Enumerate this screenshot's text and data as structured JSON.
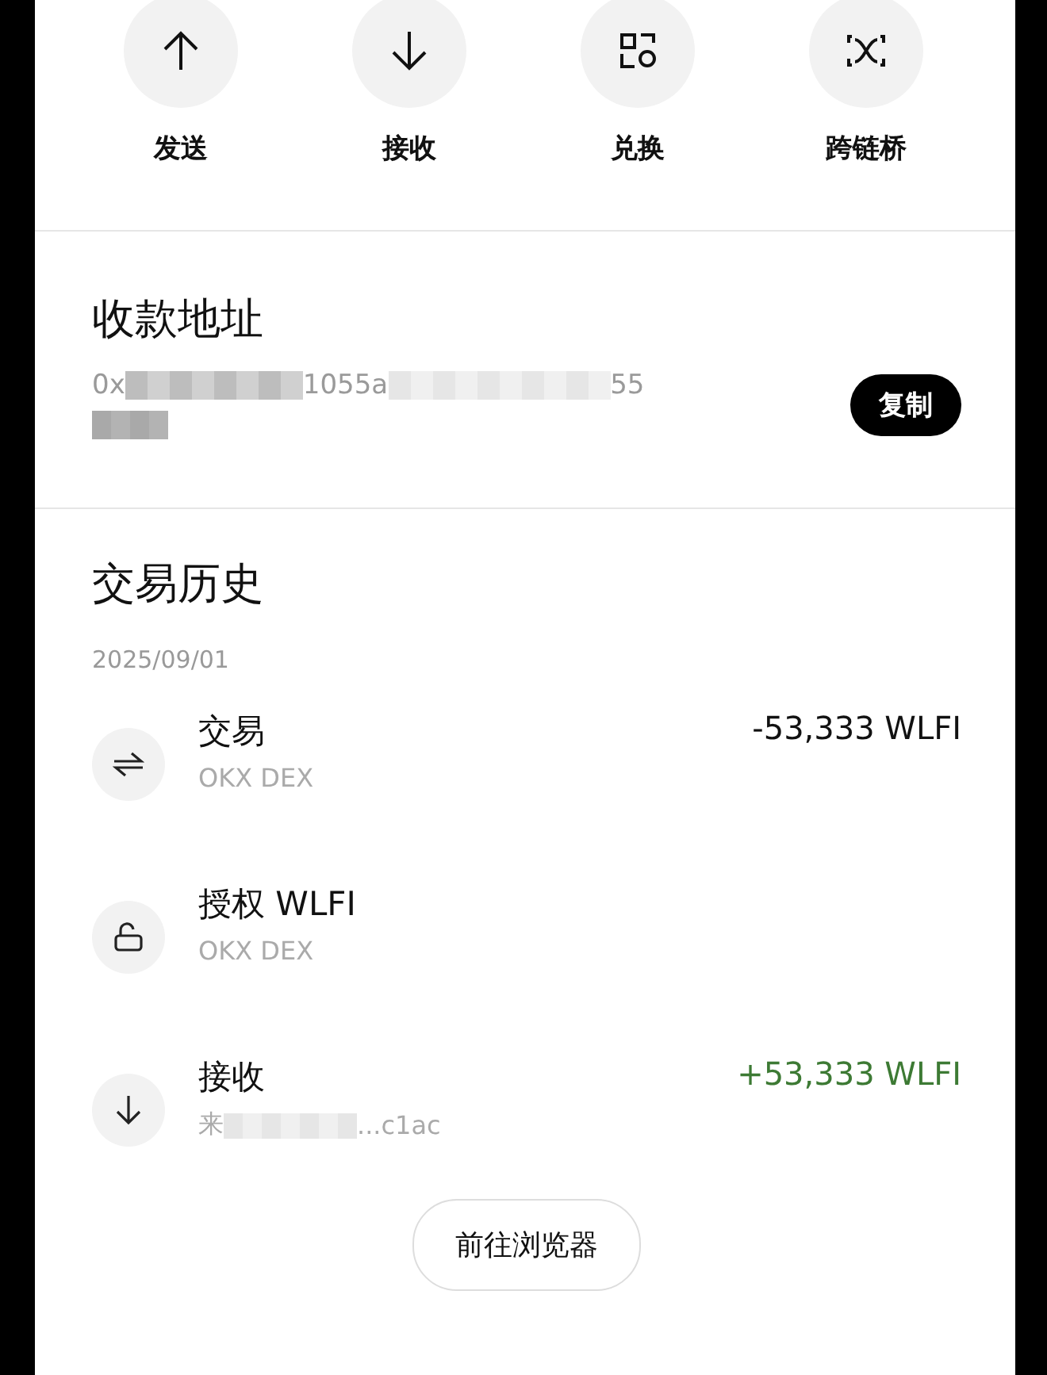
{
  "actions": [
    {
      "kind": "send",
      "label": "发送"
    },
    {
      "kind": "receive",
      "label": "接收"
    },
    {
      "kind": "swap",
      "label": "兑换"
    },
    {
      "kind": "bridge",
      "label": "跨链桥"
    }
  ],
  "address_section": {
    "title": "收款地址",
    "address_fragments": [
      "0x",
      "1055a",
      "55"
    ],
    "copy_button": "复制"
  },
  "history": {
    "title": "交易历史",
    "date": "2025/09/01",
    "transactions": [
      {
        "kind": "swap",
        "title": "交易",
        "subtitle_fragments": [
          "OKX DEX"
        ],
        "amount": "-53,333 WLFI",
        "incoming": false
      },
      {
        "kind": "approve",
        "title": "授权 WLFI",
        "subtitle_fragments": [
          "OKX DEX"
        ]
      },
      {
        "kind": "receive",
        "title": "接收",
        "subtitle_fragments": [
          "来",
          "...c1ac"
        ],
        "amount": "+53,333 WLFI",
        "incoming": true
      }
    ]
  },
  "explorer_button": "前往浏览器"
}
